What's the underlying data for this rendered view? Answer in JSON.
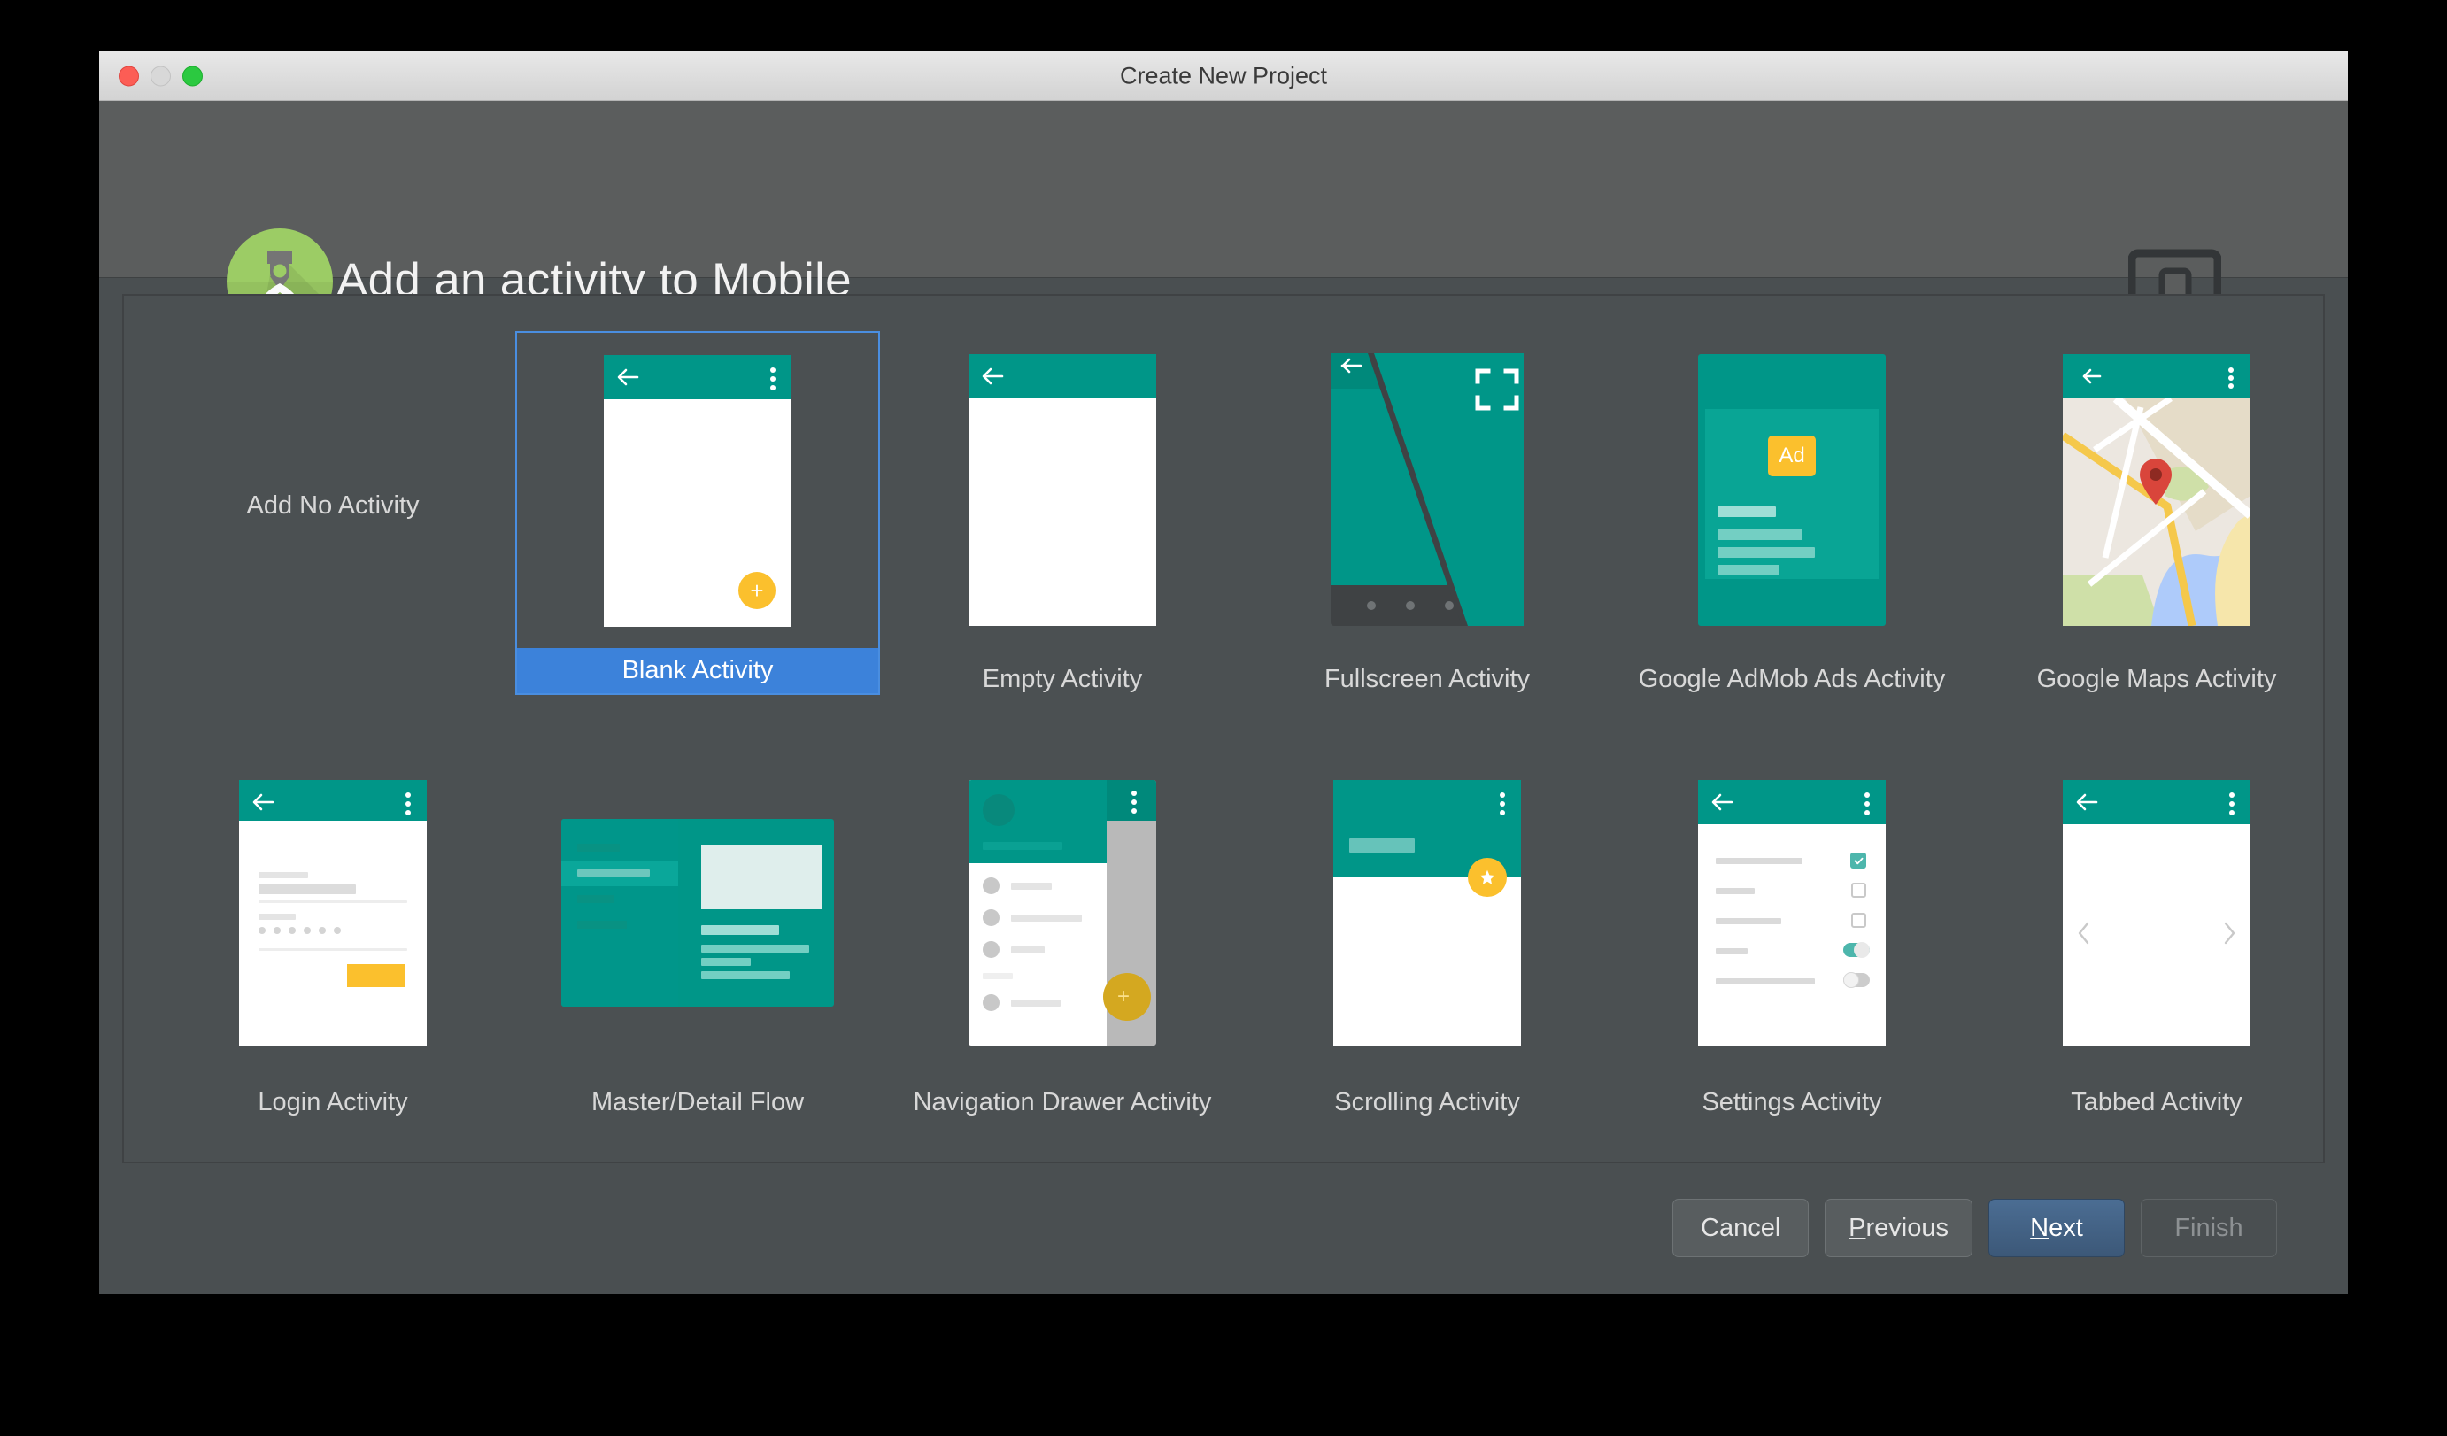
{
  "window": {
    "title": "Create New Project",
    "traffic_lights": [
      "close-button",
      "minimize-button",
      "zoom-button"
    ]
  },
  "header": {
    "title": "Add an activity to Mobile",
    "logo_icon": "android-studio-logo",
    "device_icon": "device-preview-icon"
  },
  "colors": {
    "selection_blue": "#3c82da",
    "selection_border": "#4a8ee0",
    "material_teal": "#009688",
    "material_amber": "#fbc02d",
    "window_bg": "#4a4f51",
    "panel_bg": "#4b5052",
    "header_bg": "#5b5d5d"
  },
  "activities": {
    "selected": "Blank Activity",
    "row1": [
      {
        "label": "Add No Activity",
        "thumb": "none"
      },
      {
        "label": "Blank Activity",
        "thumb": "blank",
        "selected": true
      },
      {
        "label": "Empty Activity",
        "thumb": "empty"
      },
      {
        "label": "Fullscreen Activity",
        "thumb": "fullscreen"
      },
      {
        "label": "Google AdMob Ads Activity",
        "thumb": "admob",
        "badge": "Ad"
      },
      {
        "label": "Google Maps Activity",
        "thumb": "maps"
      }
    ],
    "row2": [
      {
        "label": "Login Activity",
        "thumb": "login"
      },
      {
        "label": "Master/Detail Flow",
        "thumb": "masterdetail"
      },
      {
        "label": "Navigation Drawer Activity",
        "thumb": "navdrawer"
      },
      {
        "label": "Scrolling Activity",
        "thumb": "scrolling"
      },
      {
        "label": "Settings Activity",
        "thumb": "settings"
      },
      {
        "label": "Tabbed Activity",
        "thumb": "tabbed"
      }
    ]
  },
  "footer": {
    "buttons": [
      {
        "label": "Cancel",
        "state": "normal",
        "mnemonic": ""
      },
      {
        "label": "Previous",
        "state": "normal",
        "mnemonic": "P"
      },
      {
        "label": "Next",
        "state": "default",
        "mnemonic": "N"
      },
      {
        "label": "Finish",
        "state": "disabled",
        "mnemonic": ""
      }
    ]
  }
}
